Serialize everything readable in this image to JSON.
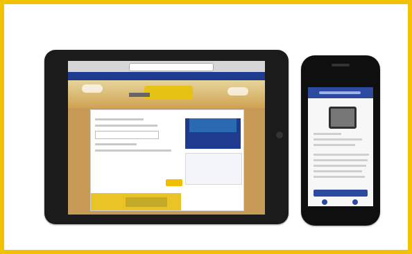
{
  "page": {
    "background_color": "#f2c200"
  },
  "tablet": {
    "device": "tablet",
    "website": {
      "brand_color": "#1f3b8f",
      "accent_color": "#f0c000",
      "hero_image": "combine-harvester-field",
      "content_button_color": "#f0c000"
    }
  },
  "phone": {
    "device": "smartphone",
    "app": {
      "header_color": "#2c4aa0",
      "product_image": "gps-display-device"
    }
  }
}
